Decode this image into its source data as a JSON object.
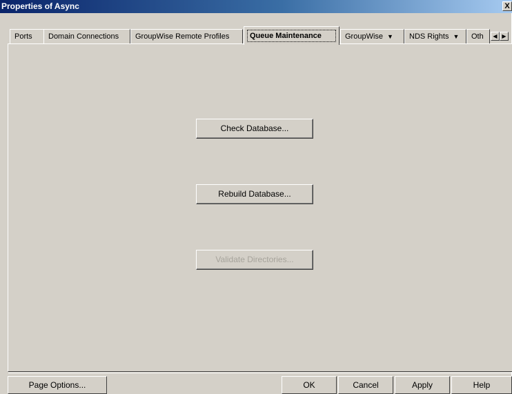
{
  "window": {
    "title": "Properties of Async",
    "close_label": "X"
  },
  "tabs": [
    {
      "label": "Ports"
    },
    {
      "label": "Domain Connections"
    },
    {
      "label": "GroupWise Remote Profiles"
    },
    {
      "label": "Queue Maintenance",
      "active": true
    },
    {
      "label": "GroupWise",
      "dropdown": true
    },
    {
      "label": "NDS Rights",
      "dropdown": true
    },
    {
      "label": "Oth"
    }
  ],
  "tab_scroll": {
    "left_icon": "scroll-left-icon",
    "right_icon": "scroll-right-icon"
  },
  "panel": {
    "buttons": [
      {
        "label": "Check Database...",
        "enabled": true
      },
      {
        "label": "Rebuild Database...",
        "enabled": true
      },
      {
        "label": "Validate Directories...",
        "enabled": false
      }
    ]
  },
  "footer": {
    "page_options": "Page Options...",
    "ok": "OK",
    "cancel": "Cancel",
    "apply": "Apply",
    "help": "Help"
  },
  "colors": {
    "face": "#d4d0c8",
    "title_start": "#0a246a",
    "title_end": "#a6caf0",
    "disabled_text": "#a6a39b"
  }
}
